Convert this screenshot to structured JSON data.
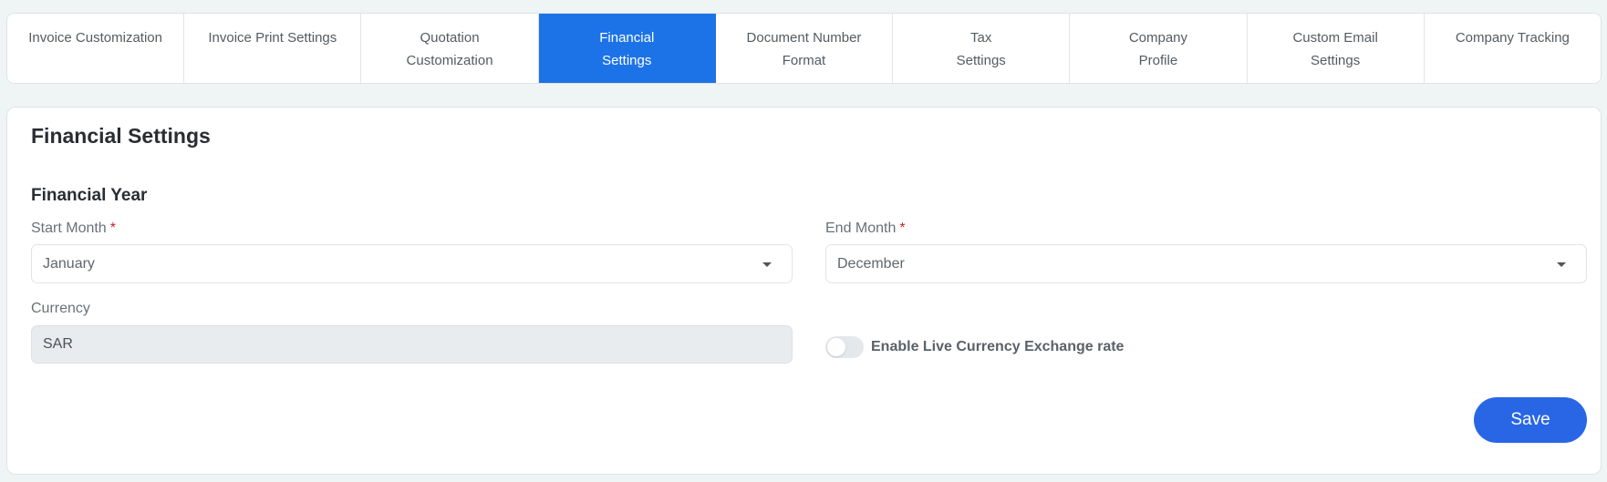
{
  "tabs": [
    {
      "label": "Invoice Customization",
      "active": false
    },
    {
      "label": "Invoice Print Settings",
      "active": false
    },
    {
      "label": "Quotation Customization",
      "active": false
    },
    {
      "label": "Financial Settings",
      "active": true
    },
    {
      "label": "Document Number Format",
      "active": false
    },
    {
      "label": "Tax Settings",
      "active": false
    },
    {
      "label": "Company Profile",
      "active": false
    },
    {
      "label": "Custom Email Settings",
      "active": false
    },
    {
      "label": "Company Tracking",
      "active": false
    }
  ],
  "page": {
    "title": "Financial Settings",
    "section_title": "Financial Year"
  },
  "form": {
    "start_month": {
      "label": "Start Month",
      "required_mark": "*",
      "value": "January"
    },
    "end_month": {
      "label": "End Month",
      "required_mark": "*",
      "value": "December"
    },
    "currency": {
      "label": "Currency",
      "value": "SAR"
    },
    "live_exchange": {
      "label": "Enable Live Currency Exchange rate",
      "enabled": false
    },
    "save_label": "Save"
  },
  "colors": {
    "active_tab": "#1c73e8",
    "save_button": "#2866e6",
    "required": "#c0282d"
  }
}
